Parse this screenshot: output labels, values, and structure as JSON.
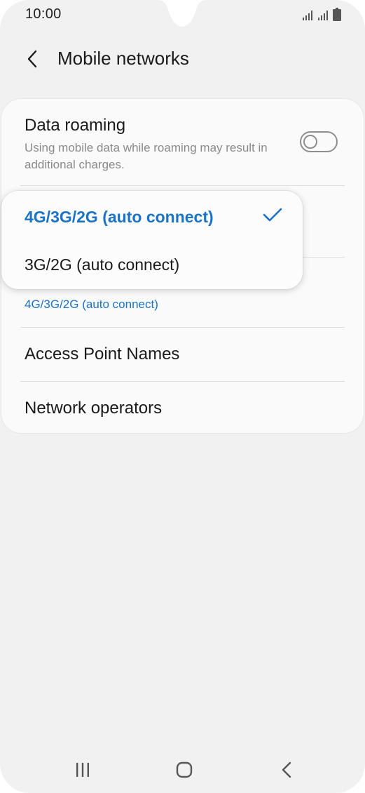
{
  "status_bar": {
    "time": "10:00",
    "icons": [
      "signal-icon",
      "signal-icon",
      "battery-icon"
    ]
  },
  "header": {
    "title": "Mobile networks",
    "back_icon": "back-arrow-icon"
  },
  "settings": {
    "data_roaming": {
      "title": "Data roaming",
      "subtitle": "Using mobile data while roaming may result in additional charges.",
      "toggle_on": false
    },
    "network_mode": {
      "value": "4G/3G/2G (auto connect)"
    },
    "access_point_names": {
      "title": "Access Point Names"
    },
    "network_operators": {
      "title": "Network operators"
    }
  },
  "popup": {
    "options": [
      {
        "label": "4G/3G/2G (auto connect)",
        "selected": true
      },
      {
        "label": "3G/2G (auto connect)",
        "selected": false
      }
    ],
    "check_icon": "checkmark-icon"
  },
  "nav_bar": {
    "icons": [
      "recent-apps-icon",
      "home-icon",
      "back-icon"
    ]
  },
  "colors": {
    "accent": "#1a73c9",
    "background": "#f1f1f1",
    "card": "#fafafa"
  }
}
